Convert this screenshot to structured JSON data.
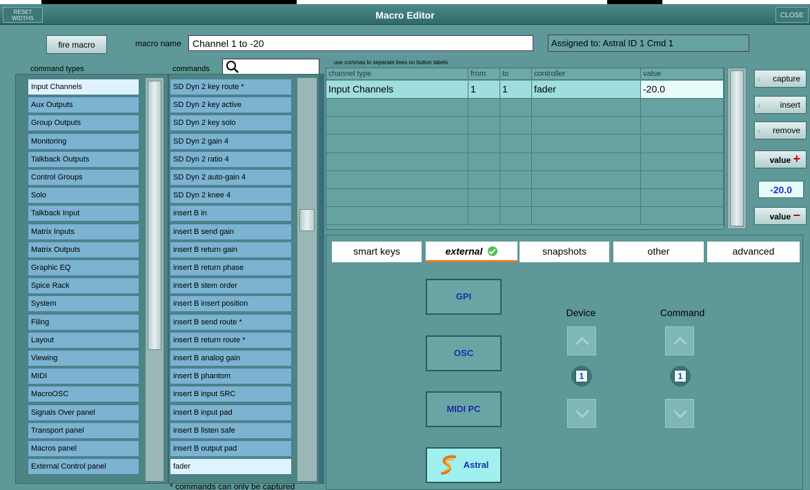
{
  "window": {
    "title": "Macro Editor",
    "reset_widths": "RESET WIDTHS",
    "close": "CLOSE"
  },
  "header": {
    "fire_macro": "fire macro",
    "macro_name_label": "macro name",
    "macro_name_value": "Channel 1 to -20",
    "assigned": "Assigned to: Astral ID 1 Cmd 1"
  },
  "command_types": {
    "label": "command types",
    "items": [
      "Input Channels",
      "Aux Outputs",
      "Group Outputs",
      "Monitoring",
      "Talkback Outputs",
      "Control Groups",
      "Solo",
      "Talkback Input",
      "Matrix Inputs",
      "Matrix Outputs",
      "Graphic EQ",
      "Spice Rack",
      "System",
      "Filing",
      "Layout",
      "Viewing",
      "MIDI",
      "MacroOSC",
      "Signals Over panel",
      "Transport panel",
      "Macros panel",
      "External Control panel"
    ],
    "selected_index": 0
  },
  "commands": {
    "label": "commands",
    "search_placeholder": "",
    "items": [
      "SD Dyn 2 key route *",
      "SD Dyn 2 key active",
      "SD Dyn 2 key solo",
      "SD Dyn 2 gain 4",
      "SD Dyn 2 ratio 4",
      "SD Dyn 2 auto-gain 4",
      "SD Dyn 2 knee 4",
      "insert B in",
      "insert B send gain",
      "insert B return gain",
      "insert B return phase",
      "insert B stem order",
      "insert B insert position",
      "insert B send route *",
      "insert B return route *",
      "insert B analog gain",
      "insert B phantom",
      "insert B input SRC",
      "insert B input pad",
      "insert B listen safe",
      "insert B output pad",
      "fader"
    ],
    "selected_index": 21,
    "footnote": "* commands can only be captured"
  },
  "grid": {
    "hint": "use commas to separate lines on button labels",
    "columns": [
      "channel type",
      "from",
      "to",
      "controller",
      "value"
    ],
    "rows": [
      [
        "Input Channels",
        "1",
        "1",
        "fader",
        "-20.0"
      ]
    ],
    "empty_rows": 7
  },
  "side_buttons": {
    "capture": "capture",
    "insert": "insert",
    "remove": "remove",
    "value_plus": "value",
    "value_display": "-20.0",
    "value_minus": "value"
  },
  "tabs": [
    "smart keys",
    "external",
    "snapshots",
    "other",
    "advanced"
  ],
  "active_tab": "external",
  "external": {
    "buttons": [
      "GPI",
      "OSC",
      "MIDI PC",
      "Astral"
    ],
    "selected": "Astral",
    "device_label": "Device",
    "device_value": "1",
    "command_label": "Command",
    "command_value": "1"
  },
  "colors": {
    "background": "#5e9898",
    "list_item": "#7bb3d1",
    "selected_item": "#dff3ff",
    "accent": "#e27b1e",
    "value_text": "#1b34c8"
  }
}
